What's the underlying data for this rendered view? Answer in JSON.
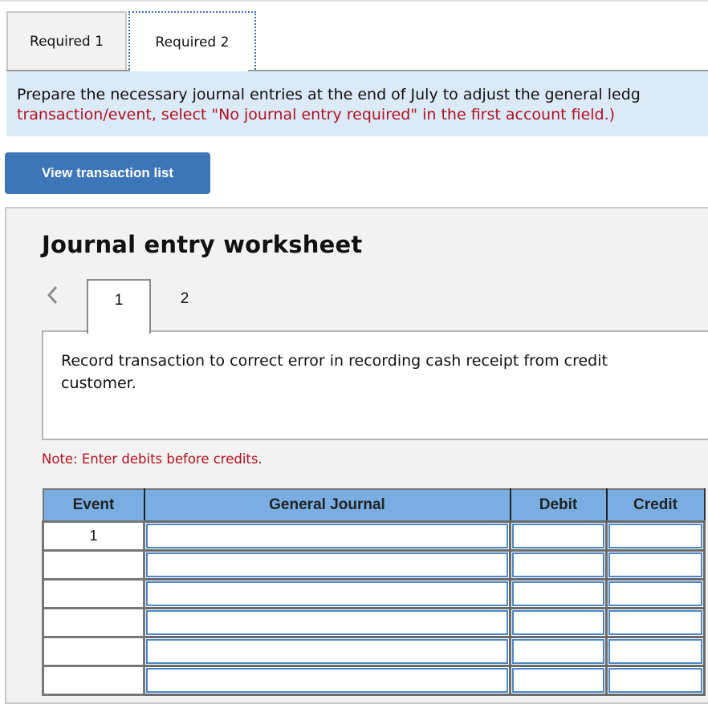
{
  "tabs": [
    {
      "label": "Required 1",
      "active": false
    },
    {
      "label": "Required 2",
      "active": true
    }
  ],
  "instructions": {
    "line1": "Prepare the necessary journal entries at the end of July to adjust the general ledg",
    "line2": "transaction/event, select \"No journal entry required\" in the first account field.)"
  },
  "view_transaction_button": "View transaction list",
  "worksheet": {
    "title": "Journal entry worksheet",
    "steps": [
      "1",
      "2"
    ],
    "active_step": "1",
    "description": "Record transaction to correct error in recording cash receipt from credit customer.",
    "note": "Note: Enter debits before credits."
  },
  "journal_table": {
    "columns": [
      "Event",
      "General Journal",
      "Debit",
      "Credit"
    ],
    "rows": [
      {
        "event": "1",
        "account": "",
        "debit": "",
        "credit": ""
      },
      {
        "event": "",
        "account": "",
        "debit": "",
        "credit": ""
      },
      {
        "event": "",
        "account": "",
        "debit": "",
        "credit": ""
      },
      {
        "event": "",
        "account": "",
        "debit": "",
        "credit": ""
      },
      {
        "event": "",
        "account": "",
        "debit": "",
        "credit": ""
      },
      {
        "event": "",
        "account": "",
        "debit": "",
        "credit": ""
      }
    ]
  },
  "colors": {
    "accent_blue": "#3d76b8",
    "header_blue": "#7aaee3",
    "instruction_bg": "#dbeaf8",
    "error_red": "#b3101e"
  }
}
